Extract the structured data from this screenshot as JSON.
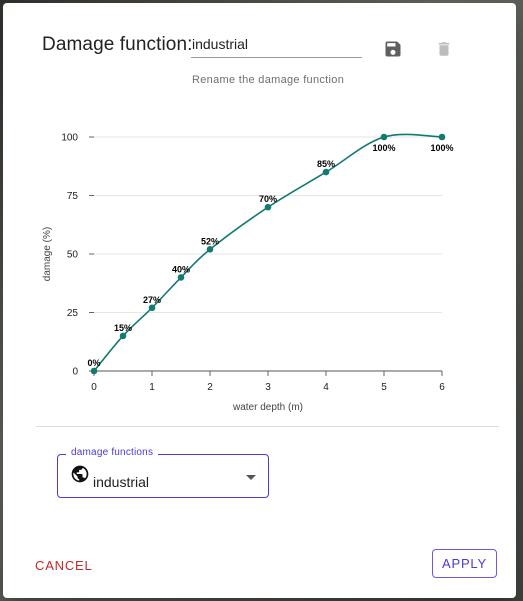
{
  "dialog": {
    "title_label": "Damage function:",
    "name_value": "industrial",
    "helper_text": "Rename the damage function",
    "save_icon": "save-icon",
    "delete_icon": "delete-icon"
  },
  "chart_data": {
    "type": "line",
    "xlabel": "water depth (m)",
    "ylabel": "damage (%)",
    "xlim": [
      0,
      6
    ],
    "ylim": [
      0,
      100
    ],
    "x_ticks": [
      "0",
      "1",
      "2",
      "3",
      "4",
      "5",
      "6"
    ],
    "y_ticks": [
      "0",
      "25",
      "50",
      "75",
      "100"
    ],
    "grid": "horizontal",
    "color": "#137a72",
    "points": [
      {
        "x": 0,
        "y": 0,
        "label": "0%"
      },
      {
        "x": 0.5,
        "y": 15,
        "label": "15%"
      },
      {
        "x": 1,
        "y": 27,
        "label": "27%"
      },
      {
        "x": 1.5,
        "y": 40,
        "label": "40%"
      },
      {
        "x": 2,
        "y": 52,
        "label": "52%"
      },
      {
        "x": 3,
        "y": 70,
        "label": "70%"
      },
      {
        "x": 4,
        "y": 85,
        "label": "85%"
      },
      {
        "x": 5,
        "y": 100,
        "label": "100%"
      },
      {
        "x": 6,
        "y": 100,
        "label": "100%"
      }
    ]
  },
  "selector": {
    "legend": "damage functions",
    "value": "industrial",
    "icon": "globe-icon",
    "accent": "#4a3ad6"
  },
  "actions": {
    "cancel_label": "CANCEL",
    "apply_label": "APPLY",
    "cancel_color": "#c62828"
  }
}
